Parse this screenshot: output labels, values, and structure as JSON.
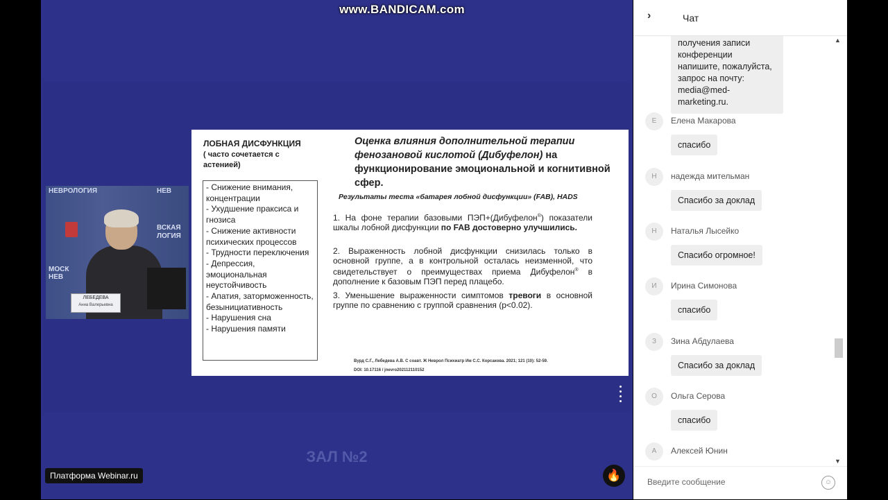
{
  "watermark": "www.BANDICAM.com",
  "camera": {
    "logo_left": "НЕВРОЛОГИЯ",
    "logo_right": "НЕВ",
    "banner_text": "ВСКАЯ\nЛОГИЯ",
    "banner_text_left": "МОСК\nНЕВ",
    "nameplate_name": "ЛЕБЕДЕВА",
    "nameplate_sub": "Анна Валерьевна"
  },
  "slide": {
    "left_title": "ЛОБНАЯ ДИСФУНКЦИЯ",
    "left_subtitle": "( часто сочетается с астенией)",
    "symptoms": [
      "- Снижение внимания, концентрации",
      "- Ухудшение праксиса и гнозиса",
      "- Снижение активности психических процессов",
      "- Трудности переключения",
      "- Депрессия, эмоциональная неустойчивость",
      "- Апатия, заторможенность, безынициативность",
      "- Нарушения сна",
      "- Нарушения памяти"
    ],
    "title_italic": "Оценка влияния дополнительной терапии фенозановой кислотой (Дибуфелон)",
    "title_rest": " на функционирование эмоциональной и когнитивной сфер.",
    "subtitle": "Результаты теста «батарея лобной дисфункции» (FAB), HADS",
    "p1_a": "1. На фоне терапии базовыми ПЭП+(Дибуфелон",
    "p1_sup": "®",
    "p1_b": ") показатели шкалы лобной дисфункции ",
    "p1_bold": "по FAB достоверно улучшились.",
    "p2_a": "2. Выраженность лобной дисфункции снизилась только в основной группе, а в контрольной осталась неизменной, что свидетельствует о преимуществах приема Дибуфелон",
    "p2_sup": "®",
    "p2_b": " в дополнение к базовым ПЭП перед плацебо.",
    "p3_a": "3. Уменьшение выраженности симптомов ",
    "p3_bold": "тревоги",
    "p3_b": " в основной группе по сравнению с группой сравнения (p<0.02).",
    "ref1": "Вурд С.Г., Лебедева А.В. С соавт. Ж Неврол Психиатр Им С.С. Корсакова. 2021; 121 (10): 52-59.",
    "ref2": "DOI: 10.17116 / jnevro202112110152"
  },
  "hall_label": "ЗАЛ №2",
  "platform_badge": "Платформа Webinar.ru",
  "fire_icon_glyph": "🔥",
  "chat": {
    "title": "Чат",
    "first_message": "получения записи конференции напишите, пожалуйста, запрос на почту: media@med-marketing.ru.",
    "messages": [
      {
        "initial": "Е",
        "author": "Елена Макарова",
        "text": "спасибо"
      },
      {
        "initial": "Н",
        "author": "надежда мительман",
        "text": "Спасибо за доклад"
      },
      {
        "initial": "Н",
        "author": "Наталья Лысейко",
        "text": "Спасибо огромное!"
      },
      {
        "initial": "И",
        "author": "Ирина Симонова",
        "text": "спасибо"
      },
      {
        "initial": "З",
        "author": "Зина Абдулаева",
        "text": "Спасибо за доклад"
      },
      {
        "initial": "О",
        "author": "Ольга Серова",
        "text": "спасибо"
      },
      {
        "initial": "А",
        "author": "Алексей Юнин",
        "text": ""
      }
    ],
    "input_placeholder": "Введите сообщение"
  }
}
